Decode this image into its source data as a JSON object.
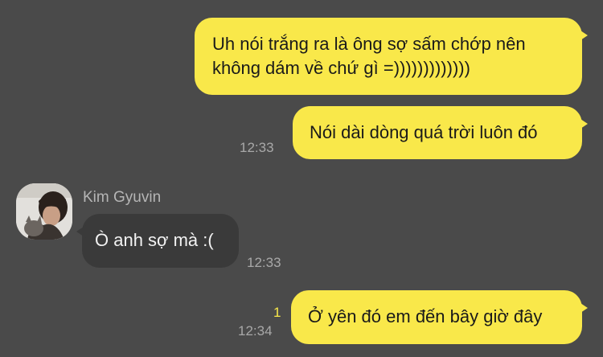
{
  "messages": [
    {
      "direction": "outgoing",
      "lines": [
        "Uh nói trắng ra là ông sợ sấm chớp nên",
        "không dám về chứ gì =)))))))))))))"
      ]
    },
    {
      "direction": "outgoing",
      "text": "Nói dài dòng quá trời luôn đó",
      "time": "12:33"
    },
    {
      "direction": "incoming",
      "sender": "Kim Gyuvin",
      "avatar_icon": "profile-photo",
      "text": "Ò anh sợ mà :(",
      "time": "12:33"
    },
    {
      "direction": "outgoing",
      "text": "Ở yên đó em đến bây giờ đây",
      "time": "12:34",
      "unread_count": "1"
    }
  ],
  "colors": {
    "background": "#4a4a4a",
    "outgoing_bubble": "#f9e84a",
    "incoming_bubble": "#3a3a3a",
    "timestamp": "#a8a8a8",
    "unread": "#f9e84a"
  }
}
